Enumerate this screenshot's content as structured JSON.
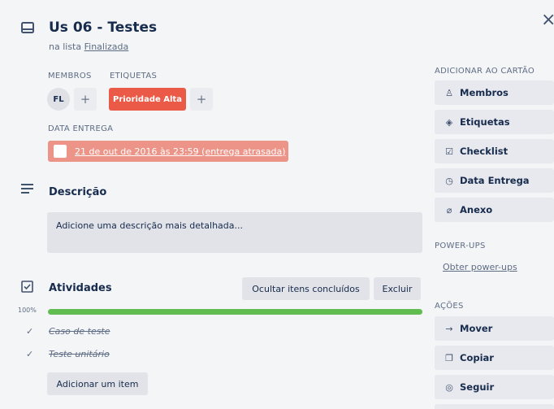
{
  "card": {
    "title": "Us 06 - Testes",
    "list_prefix": "na lista ",
    "list_name": "Finalizada"
  },
  "members": {
    "label": "MEMBROS",
    "avatar_initials": "FL",
    "add_glyph": "+"
  },
  "labels": {
    "label": "ETIQUETAS",
    "items": [
      "Prioridade Alta"
    ],
    "color": "#eb5a46",
    "add_glyph": "+"
  },
  "due": {
    "label": "DATA ENTREGA",
    "value": "21 de out de 2016 às 23:59 (entrega atrasada)",
    "color": "#ec9488"
  },
  "description": {
    "heading": "Descrição",
    "placeholder": "Adicione uma descrição mais detalhada..."
  },
  "checklist": {
    "heading": "Atividades",
    "hide_button": "Ocultar itens concluídos",
    "delete_button": "Excluir",
    "progress_text": "100%",
    "progress": 1.0,
    "progress_color": "#61bd4f",
    "items": [
      {
        "text": "Caso de teste",
        "done": true
      },
      {
        "text": "Teste unitário",
        "done": true
      }
    ],
    "add_item_button": "Adicionar um item"
  },
  "sidebar": {
    "add_heading": "ADICIONAR AO CARTÃO",
    "add_buttons": [
      {
        "label": "Membros",
        "icon": "person-icon"
      },
      {
        "label": "Etiquetas",
        "icon": "tag-icon"
      },
      {
        "label": "Checklist",
        "icon": "checkbox-icon"
      },
      {
        "label": "Data Entrega",
        "icon": "clock-icon"
      },
      {
        "label": "Anexo",
        "icon": "paperclip-icon"
      }
    ],
    "powerups_heading": "POWER-UPS",
    "powerups_link": "Obter power-ups",
    "actions_heading": "AÇÕES",
    "action_buttons": [
      {
        "label": "Mover",
        "icon": "arrow-right-icon"
      },
      {
        "label": "Copiar",
        "icon": "copy-icon"
      },
      {
        "label": "Seguir",
        "icon": "eye-icon"
      }
    ]
  },
  "close_glyph": "×"
}
